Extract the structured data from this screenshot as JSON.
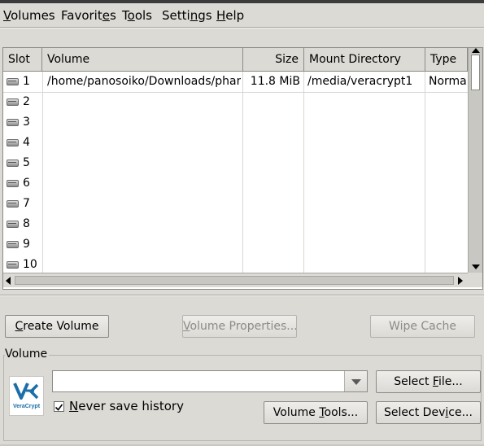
{
  "menu": {
    "volumes": "Volumes",
    "favorites": "Favorites",
    "tools": "Tools",
    "settings": "Settings",
    "help": "Help"
  },
  "table": {
    "headers": {
      "slot": "Slot",
      "volume": "Volume",
      "size": "Size",
      "mount_directory": "Mount Directory",
      "type": "Type"
    },
    "rows": [
      {
        "slot": "1",
        "volume": "/home/panosoiko/Downloads/phan...",
        "size": "11.8 MiB",
        "mount": "/media/veracrypt1",
        "type": "Norma"
      },
      {
        "slot": "2",
        "volume": "",
        "size": "",
        "mount": "",
        "type": ""
      },
      {
        "slot": "3",
        "volume": "",
        "size": "",
        "mount": "",
        "type": ""
      },
      {
        "slot": "4",
        "volume": "",
        "size": "",
        "mount": "",
        "type": ""
      },
      {
        "slot": "5",
        "volume": "",
        "size": "",
        "mount": "",
        "type": ""
      },
      {
        "slot": "6",
        "volume": "",
        "size": "",
        "mount": "",
        "type": ""
      },
      {
        "slot": "7",
        "volume": "",
        "size": "",
        "mount": "",
        "type": ""
      },
      {
        "slot": "8",
        "volume": "",
        "size": "",
        "mount": "",
        "type": ""
      },
      {
        "slot": "9",
        "volume": "",
        "size": "",
        "mount": "",
        "type": ""
      },
      {
        "slot": "10",
        "volume": "",
        "size": "",
        "mount": "",
        "type": ""
      }
    ]
  },
  "buttons": {
    "create_volume": "Create Volume",
    "volume_properties": "Volume Properties...",
    "wipe_cache": "Wipe Cache",
    "select_file": "Select File...",
    "volume_tools": "Volume Tools...",
    "select_device": "Select Device..."
  },
  "volume_group": {
    "label": "Volume",
    "path_value": "",
    "never_save_history": "Never save history",
    "never_save_history_checked": true,
    "logo_text": "VeraCrypt",
    "logo_color": "#1b6fa8"
  }
}
